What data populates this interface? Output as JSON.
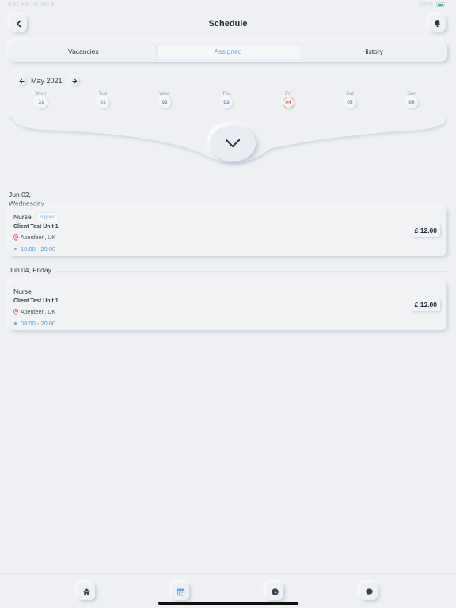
{
  "status_bar": {
    "time": "9:41 AM  Fri Jun 4",
    "battery": "100%"
  },
  "header": {
    "title": "Schedule"
  },
  "tabs": [
    {
      "label": "Vacancies",
      "active": false
    },
    {
      "label": "Assigned",
      "active": true
    },
    {
      "label": "History",
      "active": false
    }
  ],
  "calendar": {
    "month": "May 2021",
    "days": [
      {
        "name": "Mon",
        "num": "31"
      },
      {
        "name": "Tue",
        "num": "01"
      },
      {
        "name": "Wed",
        "num": "02"
      },
      {
        "name": "Thu",
        "num": "03"
      },
      {
        "name": "Fri",
        "num": "04",
        "today": true
      },
      {
        "name": "Sat",
        "num": "05"
      },
      {
        "name": "Sun",
        "num": "06"
      }
    ]
  },
  "groups": [
    {
      "date": "Jun 02, Wednesday",
      "shift": {
        "role": "Nurse",
        "badge": "Signed",
        "client": "Client Test Unit 1",
        "location": "Aberdeen, UK",
        "time": "10:00 - 20:00",
        "price": "£ 12.00"
      }
    },
    {
      "date": "Jun 04, Friday",
      "shift": {
        "role": "Nurse",
        "badge": "",
        "client": "Client Test Unit 1",
        "location": "Aberdeen, UK",
        "time": "08:00 - 20:00",
        "price": "£ 12.00"
      }
    }
  ],
  "bottom_nav": [
    {
      "icon": "home-icon"
    },
    {
      "icon": "calendar-icon",
      "active": true
    },
    {
      "icon": "clock-icon"
    },
    {
      "icon": "chat-icon"
    }
  ],
  "colors": {
    "accent": "#6aa4e4",
    "today": "#e0625c",
    "background": "#eef0f3"
  }
}
